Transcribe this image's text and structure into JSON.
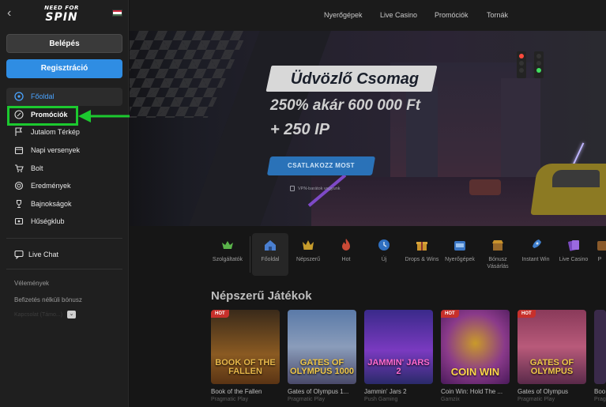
{
  "brand": {
    "logo_line1": "NEED FOR",
    "logo_line2": "SPIN"
  },
  "colors": {
    "accent_blue": "#2f8de3",
    "highlight_green": "#1cc92f",
    "hot_badge": "#c7302b"
  },
  "auth": {
    "login_label": "Belépés",
    "register_label": "Regisztráció"
  },
  "sidebar": {
    "items": [
      {
        "label": "Főoldal",
        "icon": "compass-icon"
      },
      {
        "label": "Promóciók",
        "icon": "percent-badge-icon"
      },
      {
        "label": "Jutalom Térkép",
        "icon": "flag-icon"
      },
      {
        "label": "Napi versenyek",
        "icon": "calendar-icon"
      },
      {
        "label": "Bolt",
        "icon": "cart-icon"
      },
      {
        "label": "Eredmények",
        "icon": "medal-icon"
      },
      {
        "label": "Bajnokságok",
        "icon": "trophy-icon"
      },
      {
        "label": "Hűségklub",
        "icon": "club-card-icon"
      }
    ],
    "live_chat": "Live Chat",
    "links": [
      "Vélemények",
      "Befizetés nélküli bónusz"
    ],
    "faded_link": "Kapcsolat (Támo...)"
  },
  "topnav": [
    "Nyerőgépek",
    "Live Casino",
    "Promóciók",
    "Tornák"
  ],
  "hero": {
    "title": "Üdvözlő Csomag",
    "line1": "250% akár 600 000 Ft",
    "line2": "+ 250 IP",
    "cta": "CSATLAKOZZ MOST",
    "vpn_note": "VPN-barátok vagyunk"
  },
  "categories": [
    {
      "label": "Szolgáltatók",
      "icon": "crown-wings-icon"
    },
    {
      "label": "Főoldal",
      "icon": "home-icon"
    },
    {
      "label": "Népszerű",
      "icon": "crown-icon"
    },
    {
      "label": "Hot",
      "icon": "flame-icon"
    },
    {
      "label": "Új",
      "icon": "clock-icon"
    },
    {
      "label": "Drops & Wins",
      "icon": "gift-icon"
    },
    {
      "label": "Nyerőgépek",
      "icon": "slot-machine-icon"
    },
    {
      "label": "Bónusz Vásárlás",
      "icon": "shop-icon"
    },
    {
      "label": "Instant Win",
      "icon": "rocket-icon"
    },
    {
      "label": "Live Casino",
      "icon": "cards-icon"
    },
    {
      "label": "P",
      "icon": "partial-icon"
    }
  ],
  "popular": {
    "title": "Népszerű Játékok",
    "games": [
      {
        "name": "Book of the Fallen",
        "provider": "Pragmatic Play",
        "thumb_text": "BOOK OF THE FALLEN",
        "hot": "HOT"
      },
      {
        "name": "Gates of Olympus 1...",
        "provider": "Pragmatic Play",
        "thumb_text": "GATES OF OLYMPUS 1000",
        "hot": ""
      },
      {
        "name": "Jammin' Jars 2",
        "provider": "Push Gaming",
        "thumb_text": "JAMMIN' JARS 2",
        "hot": ""
      },
      {
        "name": "Coin Win: Hold The ...",
        "provider": "Gamzix",
        "thumb_text": "COIN WIN",
        "hot": "HOT"
      },
      {
        "name": "Gates of Olympus",
        "provider": "Pragmatic Play",
        "thumb_text": "GATES OF OLYMPUS",
        "hot": "HOT"
      },
      {
        "name": "Boo",
        "provider": "Prag",
        "thumb_text": "",
        "hot": ""
      }
    ]
  }
}
